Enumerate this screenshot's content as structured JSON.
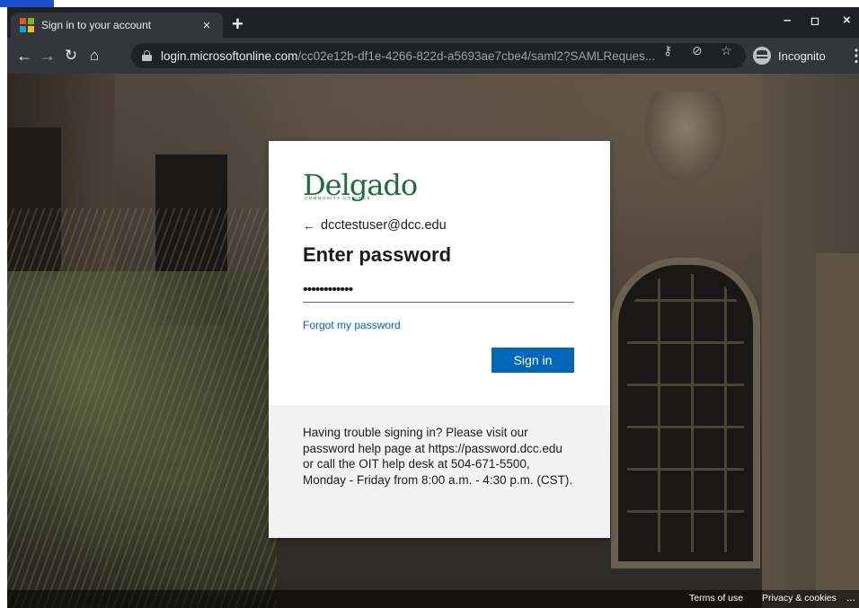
{
  "browser": {
    "tab_title": "Sign in to your account",
    "new_tab": "+",
    "close_tab": "×",
    "url_host": "login.microsoftonline.com",
    "url_path": "/cc02e12b-df1e-4266-822d-a5693ae7cbe4/saml2?SAMLReques...",
    "incognito_label": "Incognito",
    "icons": [
      "back-icon",
      "forward-icon",
      "reload-icon",
      "home-icon",
      "lock-icon",
      "key-icon",
      "eye-off-icon",
      "star-icon",
      "incognito-icon",
      "more-icon"
    ],
    "window_controls": [
      "minimize",
      "maximize",
      "close"
    ]
  },
  "signin": {
    "logo_text": "Delgado",
    "logo_sub": "COMMUNITY COLLEGE",
    "back_arrow": "←",
    "username": "dcctestuser@dcc.edu",
    "heading": "Enter password",
    "password_mask": "••••••••••••",
    "forgot_link": "Forgot my password",
    "signin_button": "Sign in",
    "brand_color": "#1f6b3a",
    "accent_color": "#0067b8"
  },
  "help": {
    "text": "Having trouble signing in? Please visit our password help page at https://password.dcc.edu or call the OIT help desk at 504-671-5500, Monday - Friday from 8:00 a.m. - 4:30 p.m. (CST)."
  },
  "footer": {
    "terms": "Terms of use",
    "privacy": "Privacy & cookies",
    "more": "..."
  }
}
